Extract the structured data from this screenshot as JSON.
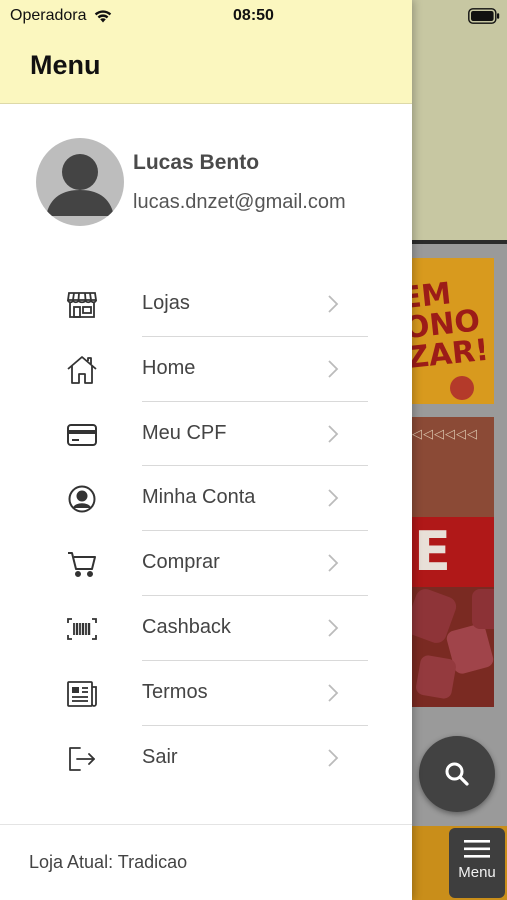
{
  "status_bar": {
    "carrier": "Operadora",
    "time": "08:50"
  },
  "drawer": {
    "title": "Menu",
    "user": {
      "name": "Lucas Bento",
      "email": "lucas.dnzet@gmail.com"
    },
    "items": [
      {
        "label": "Lojas",
        "icon": "store-icon"
      },
      {
        "label": "Home",
        "icon": "home-icon"
      },
      {
        "label": "Meu CPF",
        "icon": "card-icon"
      },
      {
        "label": "Minha Conta",
        "icon": "account-circle-icon"
      },
      {
        "label": "Comprar",
        "icon": "cart-icon"
      },
      {
        "label": "Cashback",
        "icon": "barcode-icon"
      },
      {
        "label": "Termos",
        "icon": "document-icon"
      },
      {
        "label": "Sair",
        "icon": "logout-icon"
      }
    ],
    "current_store": "Loja Atual: Tradicao"
  },
  "background": {
    "menu_button_label": "Menu",
    "banner1_text": "EM\nONO\nZAR!"
  },
  "colors": {
    "drawer_header_bg": "#fbf7bf",
    "fab_bg": "#424242",
    "text_primary": "#444444"
  }
}
